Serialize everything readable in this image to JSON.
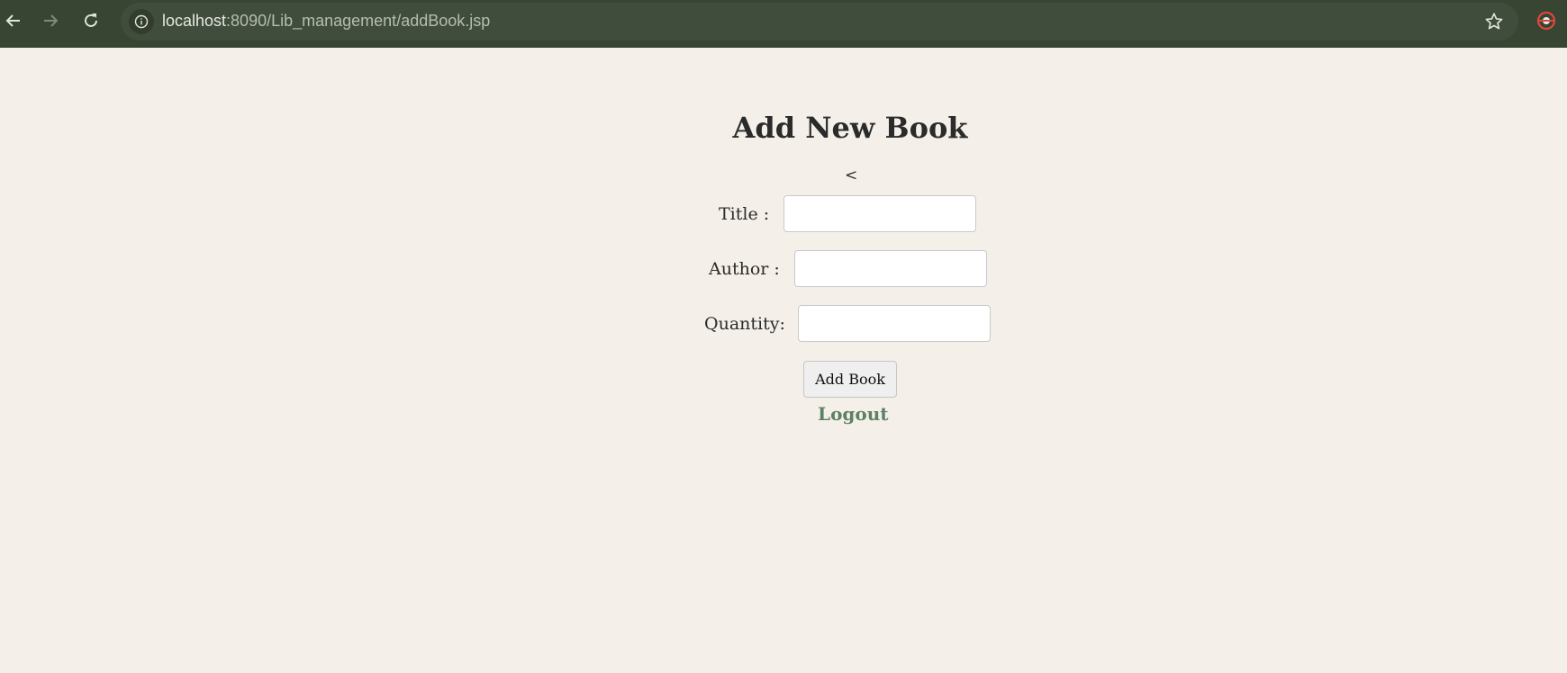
{
  "browser": {
    "url_host": "localhost",
    "url_rest": ":8090/Lib_management/addBook.jsp"
  },
  "page": {
    "title": "Add New Book",
    "stray_text": "<",
    "fields": [
      {
        "label": "Title :",
        "value": ""
      },
      {
        "label": "Author :",
        "value": ""
      },
      {
        "label": "Quantity:",
        "value": ""
      }
    ],
    "submit_label": "Add Book",
    "logout_label": "Logout"
  },
  "colors": {
    "background": "#f4f0e9",
    "toolbar": "#374532",
    "link": "#5e8165"
  }
}
